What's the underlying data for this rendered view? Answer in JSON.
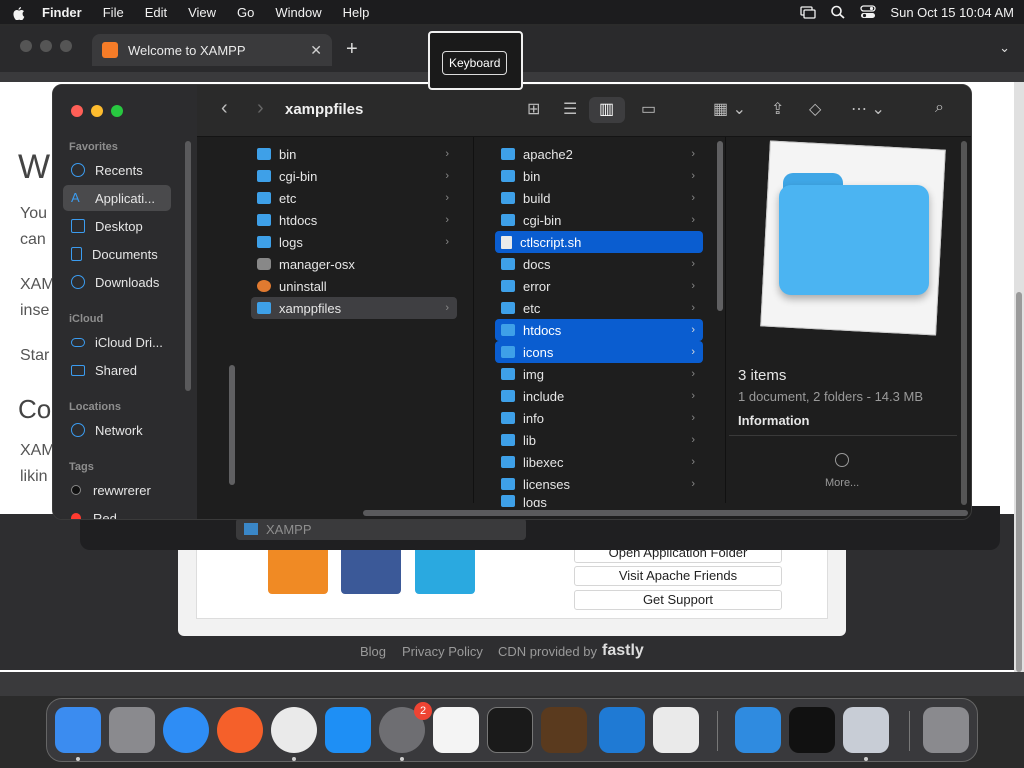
{
  "menubar": {
    "app": "Finder",
    "items": [
      "File",
      "Edit",
      "View",
      "Go",
      "Window",
      "Help"
    ],
    "clock": "Sun Oct 15  10:04 AM"
  },
  "browser": {
    "tab_title": "Welcome to XAMPP",
    "page_heading_fragment": "W",
    "page_text_1": "You",
    "page_text_2": "can",
    "page_text_3": "XAM",
    "page_text_4": "inse",
    "page_text_5": "Star",
    "page_heading_2": "Co",
    "page_text_6": "XAM",
    "page_text_7": "likin",
    "links": [
      "Open Application Folder",
      "Visit Apache Friends",
      "Get Support"
    ],
    "footer": {
      "blog": "Blog",
      "privacy": "Privacy Policy",
      "cdn": "CDN provided by",
      "brand": "fastly"
    }
  },
  "keyboard_overlay": "Keyboard",
  "finder": {
    "title": "xamppfiles",
    "sidebar": {
      "favorites_header": "Favorites",
      "favorites": [
        "Recents",
        "Applicati...",
        "Desktop",
        "Documents",
        "Downloads"
      ],
      "icloud_header": "iCloud",
      "icloud": [
        "iCloud Dri...",
        "Shared"
      ],
      "locations_header": "Locations",
      "locations": [
        "Network"
      ],
      "tags_header": "Tags",
      "tags": [
        "rewwrerer",
        "Red"
      ]
    },
    "column1": [
      "bin",
      "cgi-bin",
      "etc",
      "htdocs",
      "logs",
      "manager-osx",
      "uninstall",
      "xamppfiles"
    ],
    "column2": [
      "apache2",
      "bin",
      "build",
      "cgi-bin",
      "ctlscript.sh",
      "docs",
      "error",
      "etc",
      "htdocs",
      "icons",
      "img",
      "include",
      "info",
      "lib",
      "libexec",
      "licenses",
      "logs"
    ],
    "preview": {
      "title": "3 items",
      "subtitle": "1 document, 2 folders - 14.3 MB",
      "info_label": "Information",
      "more_label": "More..."
    },
    "ghost_row": "XAMPP"
  },
  "dock": {
    "apps": [
      "finder-icon",
      "launchpad-icon",
      "safari-icon",
      "firefox-icon",
      "chrome-icon",
      "app-store-icon",
      "system-settings-icon",
      "textedit-icon",
      "terminal-icon",
      "garageband-icon",
      "vscode-icon",
      "roblox-icon",
      "weather-icon",
      "apple-tv-icon",
      "utility-icon",
      "trash-icon"
    ],
    "badge": "2"
  }
}
